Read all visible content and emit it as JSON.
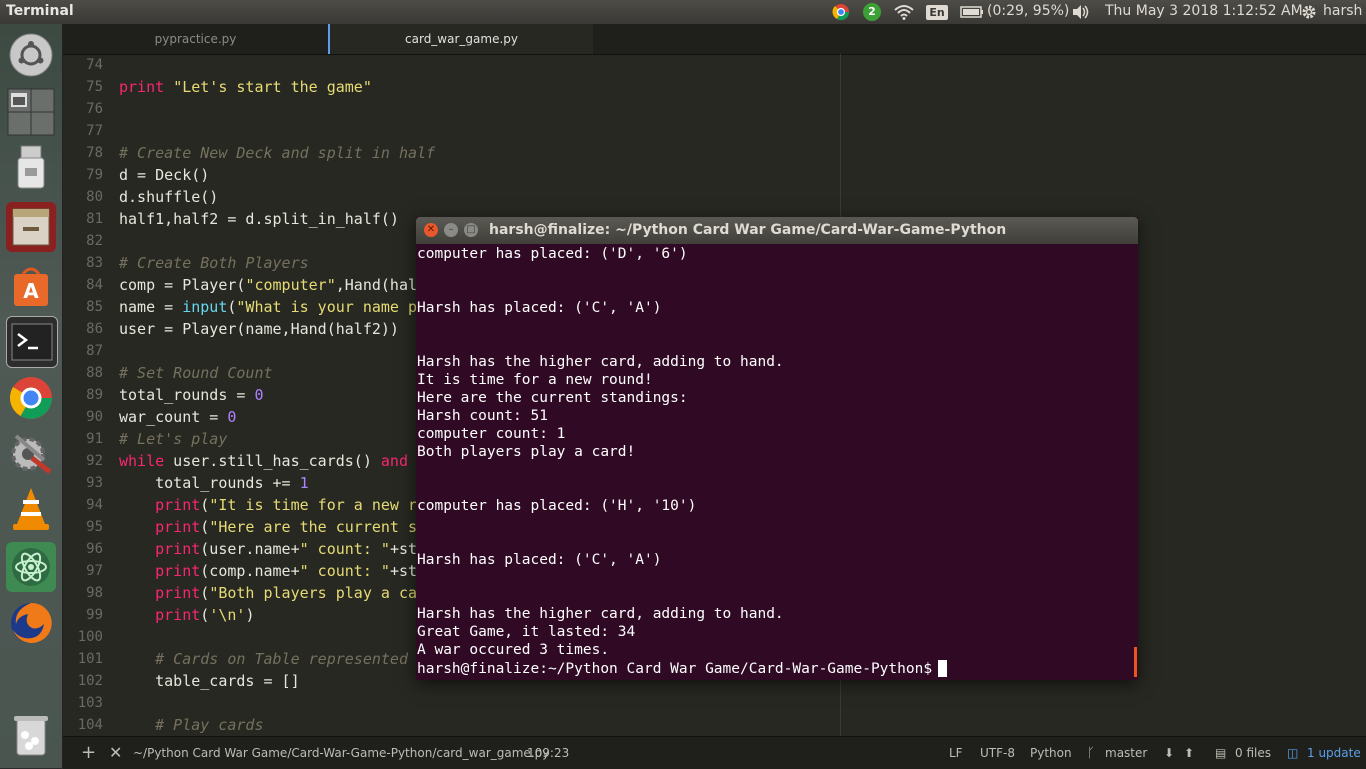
{
  "top_panel": {
    "app_title": "Terminal",
    "chrome_badge": "2",
    "keyboard_layout": "En",
    "battery": "(0:29, 95%)",
    "datetime": "Thu May  3 2018  1:12:52 AM",
    "user": "harsh"
  },
  "launcher": {
    "items": [
      "ubuntu-dash-icon",
      "workspace-switcher-icon",
      "usb-drive-icon",
      "file-cabinet-icon",
      "software-center-icon",
      "terminal-icon",
      "chrome-icon",
      "system-settings-icon",
      "vlc-icon",
      "atom-icon",
      "firefox-icon",
      "trash-icon"
    ]
  },
  "editor": {
    "tabs": [
      "pypractice.py",
      "card_war_game.py"
    ],
    "lines": [
      {
        "n": "74",
        "html": ""
      },
      {
        "n": "75",
        "html": "<span class='kw'>print</span> <span class='str'>\"Let's start the game\"</span>"
      },
      {
        "n": "76",
        "html": ""
      },
      {
        "n": "77",
        "html": ""
      },
      {
        "n": "78",
        "html": "<span class='cm'># Create New Deck and split in half</span>"
      },
      {
        "n": "79",
        "html": "d = Deck()"
      },
      {
        "n": "80",
        "html": "d.shuffle()"
      },
      {
        "n": "81",
        "html": "half1,half2 = d.split_in_half()"
      },
      {
        "n": "82",
        "html": ""
      },
      {
        "n": "83",
        "html": "<span class='cm'># Create Both Players</span>"
      },
      {
        "n": "84",
        "html": "comp = Player(<span class='str'>\"computer\"</span>,Hand(hal"
      },
      {
        "n": "85",
        "html": "name = <span class='bi'>input</span>(<span class='str'>\"What is your name p</span>"
      },
      {
        "n": "86",
        "html": "user = Player(name,Hand(half2))"
      },
      {
        "n": "87",
        "html": ""
      },
      {
        "n": "88",
        "html": "<span class='cm'># Set Round Count</span>"
      },
      {
        "n": "89",
        "html": "total_rounds = <span class='num'>0</span>"
      },
      {
        "n": "90",
        "html": "war_count = <span class='num'>0</span>"
      },
      {
        "n": "91",
        "html": "<span class='cm'># Let's play</span>"
      },
      {
        "n": "92",
        "html": "<span class='kw'>while</span> user.still_has_cards() <span class='kw'>and</span>"
      },
      {
        "n": "93",
        "html": "    total_rounds += <span class='num'>1</span>"
      },
      {
        "n": "94",
        "html": "    <span class='kw'>print</span>(<span class='str'>\"It is time for a new r</span>"
      },
      {
        "n": "95",
        "html": "    <span class='kw'>print</span>(<span class='str'>\"Here are the current s</span>"
      },
      {
        "n": "96",
        "html": "    <span class='kw'>print</span>(user.name+<span class='str'>\" count: \"</span>+st"
      },
      {
        "n": "97",
        "html": "    <span class='kw'>print</span>(comp.name+<span class='str'>\" count: \"</span>+st"
      },
      {
        "n": "98",
        "html": "    <span class='kw'>print</span>(<span class='str'>\"Both players play a ca</span>"
      },
      {
        "n": "99",
        "html": "    <span class='kw'>print</span>(<span class='str'>'\\n'</span>)"
      },
      {
        "n": "100",
        "html": ""
      },
      {
        "n": "101",
        "html": "    <span class='cm'># Cards on Table represented</span>"
      },
      {
        "n": "102",
        "html": "    table_cards = []"
      },
      {
        "n": "103",
        "html": ""
      },
      {
        "n": "104",
        "html": "    <span class='cm'># Play cards</span>"
      }
    ]
  },
  "statusbar": {
    "file_path": "~/Python Card War Game/Card-War-Game-Python/card_war_game.py",
    "cursor_pos": "109:23",
    "line_ending": "LF",
    "encoding": "UTF-8",
    "grammar": "Python",
    "branch": "master",
    "files": "0 files",
    "update": "1 update"
  },
  "terminal": {
    "title": "harsh@finalize: ~/Python Card War Game/Card-War-Game-Python",
    "lines": [
      "computer has placed: ('D', '6')",
      "",
      "",
      "Harsh has placed: ('C', 'A')",
      "",
      "",
      "Harsh has the higher card, adding to hand.",
      "It is time for a new round!",
      "Here are the current standings:",
      "Harsh count: 51",
      "computer count: 1",
      "Both players play a card!",
      "",
      "",
      "computer has placed: ('H', '10')",
      "",
      "",
      "Harsh has placed: ('C', 'A')",
      "",
      "",
      "Harsh has the higher card, adding to hand.",
      "Great Game, it lasted: 34",
      "A war occured 3 times."
    ],
    "prompt": "harsh@finalize:~/Python Card War Game/Card-War-Game-Python$"
  }
}
